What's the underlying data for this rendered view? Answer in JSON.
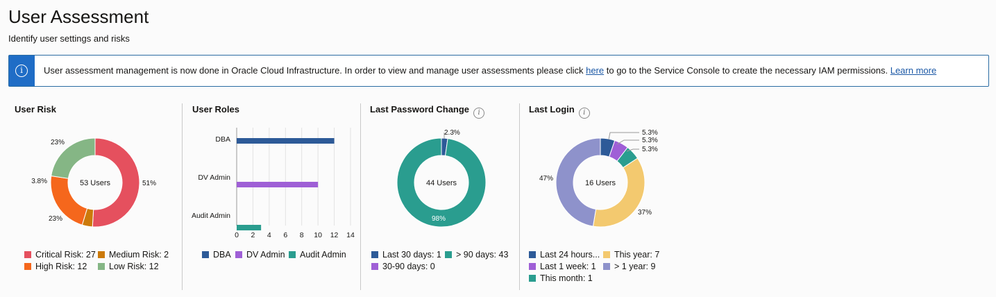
{
  "page": {
    "title": "User Assessment",
    "subtitle": "Identify user settings and risks"
  },
  "banner": {
    "icon": "info-icon",
    "text_before": "User assessment management is now done in Oracle Cloud Infrastructure. In order to view and manage user assessments please click ",
    "here_link": "here",
    "text_after": " to go to the Service Console to create the necessary IAM permissions. ",
    "learn_more_link": "Learn more"
  },
  "colors": {
    "critical": "#e5505e",
    "medium": "#cc7a0a",
    "high": "#f5671c",
    "low": "#85b685",
    "dba": "#2d5a98",
    "dv_admin": "#9f5fd6",
    "audit_admin": "#2a9d8f",
    "this_year": "#f3c96f",
    "over_year": "#8e92cb",
    "last24": "#2d5a98",
    "week": "#9f5fd6",
    "month": "#2a9d8f"
  },
  "chart_data": [
    {
      "type": "pie",
      "title": "User Risk",
      "center_label": "53 Users",
      "categories": [
        "Critical Risk",
        "Medium Risk",
        "High Risk",
        "Low Risk"
      ],
      "values": [
        27,
        2,
        12,
        12
      ],
      "slice_labels": [
        "51%",
        "3.8%",
        "23%",
        "23%"
      ],
      "legend": [
        "Critical Risk: 27",
        "Medium Risk: 2",
        "High Risk: 12",
        "Low Risk: 12"
      ]
    },
    {
      "type": "bar",
      "orientation": "horizontal",
      "title": "User Roles",
      "categories": [
        "DBA",
        "DV Admin",
        "Audit Admin"
      ],
      "values": [
        12,
        10,
        3
      ],
      "xlim": [
        0,
        14
      ],
      "xticks": [
        "0",
        "2",
        "4",
        "6",
        "8",
        "10",
        "12",
        "14"
      ],
      "grid": true,
      "legend": [
        "DBA",
        "DV Admin",
        "Audit Admin"
      ]
    },
    {
      "type": "pie",
      "title": "Last Password Change",
      "center_label": "44 Users",
      "categories": [
        "Last 30 days",
        "> 90 days",
        "30-90 days"
      ],
      "values": [
        1,
        43,
        0
      ],
      "slice_labels": [
        "2.3%",
        "98%",
        ""
      ],
      "legend": [
        "Last 30 days: 1",
        "> 90 days: 43",
        "30-90 days: 0"
      ]
    },
    {
      "type": "pie",
      "title": "Last Login",
      "center_label": "16 Users",
      "categories": [
        "Last 24 hours",
        "Last 1 week",
        "This month",
        "This year",
        "> 1 year"
      ],
      "values": [
        1,
        1,
        1,
        7,
        9
      ],
      "slice_labels": [
        "5.3%",
        "5.3%",
        "5.3%",
        "37%",
        "47%"
      ],
      "legend": [
        "Last 24 hours...",
        "This year: 7",
        "Last 1 week: 1",
        "> 1 year: 9",
        "This month: 1"
      ]
    }
  ]
}
